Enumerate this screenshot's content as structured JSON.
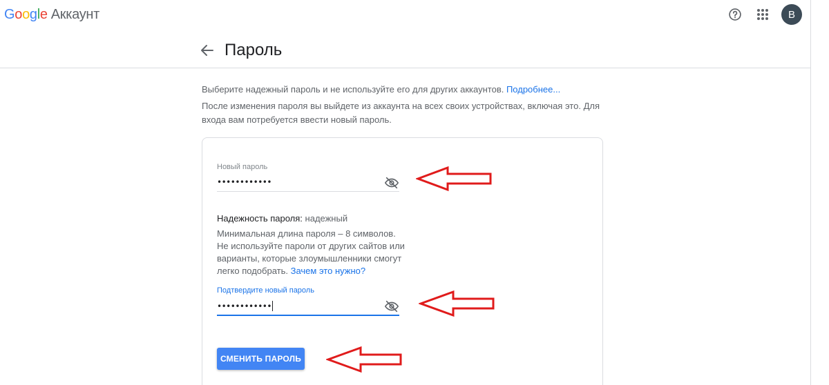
{
  "header": {
    "logo_letters": [
      "G",
      "o",
      "o",
      "g",
      "l",
      "e"
    ],
    "product_name": "Аккаунт",
    "avatar_letter": "В",
    "icons": [
      "help-circle-icon",
      "apps-grid-icon"
    ]
  },
  "page": {
    "title": "Пароль",
    "back_icon": "arrow-back-icon"
  },
  "intro": {
    "line1": "Выберите надежный пароль и не используйте его для других аккаунтов. ",
    "line1_link": "Подробнее...",
    "line2": "После изменения пароля вы выйдете из аккаунта на всех своих устройствах, включая это. Для входа вам потребуется ввести новый пароль."
  },
  "form": {
    "new_password": {
      "label": "Новый пароль",
      "masked_value": "••••••••••••",
      "toggle_icon": "eye-off-icon"
    },
    "strength": {
      "label": "Надежность пароля: ",
      "value": "надежный"
    },
    "rules_text": "Минимальная длина пароля – 8 символов. Не используйте пароли от других сайтов или варианты, которые злоумышленники смогут легко подобрать. ",
    "rules_link": "Зачем это нужно?",
    "confirm_password": {
      "label": "Подтвердите новый пароль",
      "masked_value": "••••••••••••",
      "toggle_icon": "eye-off-icon"
    },
    "submit_label": "СМЕНИТЬ ПАРОЛЬ"
  },
  "colors": {
    "brand_blue": "#4285f4",
    "link_blue": "#1a73e8",
    "annotation_red": "#e01b1b"
  }
}
